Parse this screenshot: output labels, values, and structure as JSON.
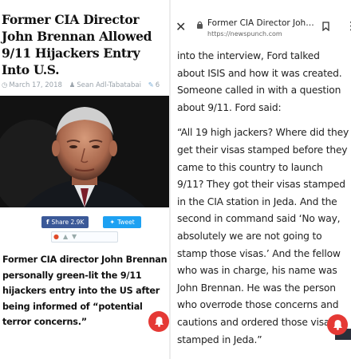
{
  "left": {
    "headline": "Former CIA Director John Brennan Allowed 9/11 Hijackers Entry Into U.S.",
    "date": "March 17, 2018",
    "author": "Sean Adl-Tabatabai",
    "comments": "6",
    "share_label": "Share 2.9K",
    "tweet_label": "Tweet",
    "lead": "Former CIA director John Brennan personally green-lit the 9/11 hijackers entry into the US after being informed of “potential terror concerns.”"
  },
  "browser": {
    "title": "Former CIA Director Joh…",
    "url": "https://newspunch.com"
  },
  "article": {
    "para1": "into the interview, Ford talked about ISIS and how it was created. Someone called in with a question about 9/11. Ford said:",
    "para2": "“All 19 high jackers? Where did they get their visas stamped before they came to this country to launch 9/11? They got their visas stamped in the CIA station in Jeda. And the second in command said ‘No way, absolutely we are not going to stamp those visas.’ And the fellow who was in charge, his name was John Brennan. He was the person who overrode those concerns and cautions and ordered those visas stamped in Jeda.”"
  },
  "colors": {
    "facebook": "#3b5998",
    "twitter": "#1da1f2",
    "bell": "#e53935"
  }
}
